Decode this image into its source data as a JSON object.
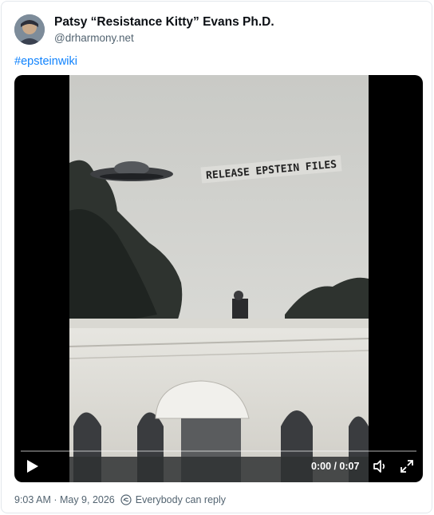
{
  "post": {
    "author_name": "Patsy “Resistance Kitty” Evans Ph.D.",
    "author_handle": "@drharmony.net",
    "text_hashtag": "#epsteinwiki",
    "timestamp": "9:03 AM · May 9, 2026",
    "reply_setting": "Everybody can reply"
  },
  "video": {
    "banner_text": "RELEASE EPSTEIN FILES",
    "time_display": "0:00 / 0:07",
    "play_icon": "play-icon",
    "mute_icon": "volume-icon",
    "fullscreen_icon": "fullscreen-icon",
    "progress_fraction": 0
  },
  "colors": {
    "link": "#1083fe",
    "secondary_text": "#536471"
  }
}
